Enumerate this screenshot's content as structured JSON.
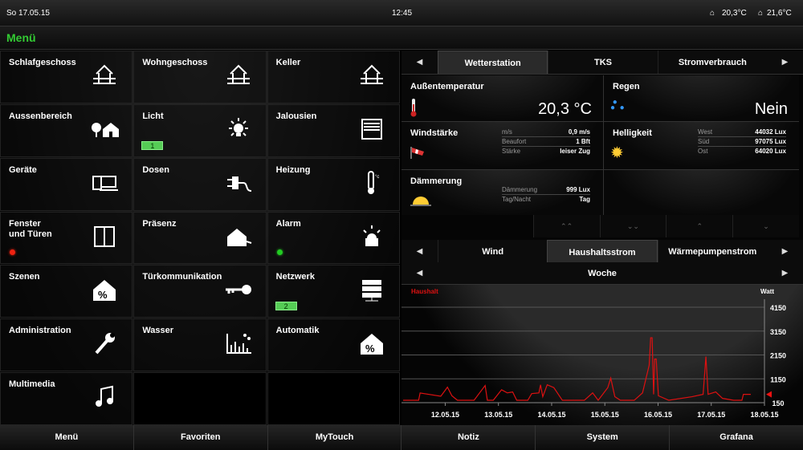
{
  "topbar": {
    "date": "So 17.05.15",
    "time": "12:45",
    "outdoor_temp": "20,3°C",
    "indoor_temp": "21,6°C"
  },
  "menubar": {
    "title": "Menü",
    "title_color": "#33cc33"
  },
  "tiles": [
    {
      "label": "Schlafgeschoss",
      "icon": "house-floor-icon"
    },
    {
      "label": "Wohngeschoss",
      "icon": "house-floor-icon"
    },
    {
      "label": "Keller",
      "icon": "house-floor-icon"
    },
    {
      "label": "Aussenbereich",
      "icon": "garden-icon"
    },
    {
      "label": "Licht",
      "icon": "bulb-icon",
      "badge": "1"
    },
    {
      "label": "Jalousien",
      "icon": "blinds-icon"
    },
    {
      "label": "Geräte",
      "icon": "laptop-icon"
    },
    {
      "label": "Dosen",
      "icon": "plug-icon"
    },
    {
      "label": "Heizung",
      "icon": "thermometer-icon"
    },
    {
      "label": "Fenster\nund Türen",
      "icon": "window-icon",
      "led": "#e21"
    },
    {
      "label": "Präsenz",
      "icon": "presence-icon"
    },
    {
      "label": "Alarm",
      "icon": "siren-icon",
      "led": "#2c2"
    },
    {
      "label": "Szenen",
      "icon": "house-percent-icon"
    },
    {
      "label": "Türkommunikation",
      "icon": "key-icon"
    },
    {
      "label": "Netzwerk",
      "icon": "server-icon",
      "badge": "2"
    },
    {
      "label": "Administration",
      "icon": "wrench-icon"
    },
    {
      "label": "Wasser",
      "icon": "water-chart-icon"
    },
    {
      "label": "Automatik",
      "icon": "house-percent-icon"
    },
    {
      "label": "Multimedia",
      "icon": "music-icon"
    }
  ],
  "top_tabs": {
    "items": [
      "Wetterstation",
      "TKS",
      "Stromverbrauch"
    ],
    "active": 0
  },
  "weather": {
    "temp": {
      "title": "Außentemperatur",
      "value": "20,3 °C"
    },
    "rain": {
      "title": "Regen",
      "value": "Nein"
    },
    "wind": {
      "title": "Windstärke",
      "rows": [
        {
          "k": "m/s",
          "v": "0,9 m/s"
        },
        {
          "k": "Beaufort",
          "v": "1 Bft"
        },
        {
          "k": "Stärke",
          "v": "leiser Zug"
        }
      ]
    },
    "light": {
      "title": "Helligkeit",
      "rows": [
        {
          "k": "West",
          "v": "44032 Lux"
        },
        {
          "k": "Süd",
          "v": "97075 Lux"
        },
        {
          "k": "Ost",
          "v": "64020 Lux"
        }
      ]
    },
    "dusk": {
      "title": "Dämmerung",
      "rows": [
        {
          "k": "Dämmerung",
          "v": "999 Lux"
        },
        {
          "k": "Tag/Nacht",
          "v": "Tag"
        }
      ]
    }
  },
  "chart_tabs": {
    "items": [
      "Wind",
      "Haushaltsstrom",
      "Wärmepumpenstrom"
    ],
    "active": 1,
    "period": "Woche"
  },
  "chart_data": {
    "type": "line",
    "series": [
      {
        "name": "Haushalt",
        "color": "#dd1111",
        "points": [
          [
            "2015-05-11T05:00",
            250
          ],
          [
            "2015-05-11T12:00",
            250
          ],
          [
            "2015-05-11T12:40",
            557
          ],
          [
            "2015-05-11T22:00",
            420
          ],
          [
            "2015-05-12T00:00",
            670
          ],
          [
            "2015-05-12T01:00",
            800
          ],
          [
            "2015-05-12T03:00",
            440
          ],
          [
            "2015-05-12T05:30",
            250
          ],
          [
            "2015-05-12T13:00",
            250
          ],
          [
            "2015-05-12T15:30",
            560
          ],
          [
            "2015-05-12T18:00",
            870
          ],
          [
            "2015-05-12T19:00",
            250
          ],
          [
            "2015-05-12T21:40",
            250
          ],
          [
            "2015-05-13T01:25",
            690
          ],
          [
            "2015-05-13T04:00",
            560
          ],
          [
            "2015-05-13T06:25",
            600
          ],
          [
            "2015-05-13T08:15",
            250
          ],
          [
            "2015-05-13T13:15",
            250
          ],
          [
            "2015-05-13T15:00",
            530
          ],
          [
            "2015-05-13T18:15",
            560
          ],
          [
            "2015-05-13T19:00",
            900
          ],
          [
            "2015-05-13T20:00",
            400
          ],
          [
            "2015-05-13T22:00",
            900
          ],
          [
            "2015-05-14T01:00",
            780
          ],
          [
            "2015-05-14T04:50",
            250
          ],
          [
            "2015-05-14T14:45",
            250
          ],
          [
            "2015-05-14T18:30",
            560
          ],
          [
            "2015-05-14T21:00",
            250
          ],
          [
            "2015-05-15T01:20",
            780
          ],
          [
            "2015-05-15T02:40",
            1180
          ],
          [
            "2015-05-15T04:30",
            400
          ],
          [
            "2015-05-15T07:00",
            250
          ],
          [
            "2015-05-15T13:15",
            250
          ],
          [
            "2015-05-15T17:00",
            560
          ],
          [
            "2015-05-15T20:00",
            1720
          ],
          [
            "2015-05-15T20:40",
            2870
          ],
          [
            "2015-05-15T21:20",
            2870
          ],
          [
            "2015-05-15T22:00",
            500
          ],
          [
            "2015-05-15T22:30",
            1980
          ],
          [
            "2015-05-15T23:10",
            1980
          ],
          [
            "2015-05-16T00:10",
            440
          ],
          [
            "2015-05-16T04:50",
            250
          ],
          [
            "2015-05-16T15:20",
            400
          ],
          [
            "2015-05-16T20:20",
            500
          ],
          [
            "2015-05-16T21:35",
            2080
          ],
          [
            "2015-05-16T22:35",
            500
          ],
          [
            "2015-05-17T02:00",
            600
          ],
          [
            "2015-05-17T05:05",
            330
          ],
          [
            "2015-05-17T10:05",
            250
          ],
          [
            "2015-05-17T13:50",
            250
          ],
          [
            "2015-05-17T14:30",
            500
          ],
          [
            "2015-05-17T17:50",
            500
          ]
        ]
      }
    ],
    "ylabel": "Watt",
    "yticks": [
      150,
      1150,
      2150,
      3150,
      4150
    ],
    "ylim": [
      150,
      4150
    ],
    "xticks": [
      "12.05.15",
      "13.05.15",
      "14.05.15",
      "15.05.15",
      "16.05.15",
      "17.05.15",
      "18.05.15"
    ],
    "xlim": [
      "2015-05-11T05:00",
      "2015-05-18T00:00"
    ],
    "current_marker": 500,
    "grid": true
  },
  "bottombar": [
    "Menü",
    "Favoriten",
    "MyTouch",
    "Notiz",
    "System",
    "Grafana"
  ]
}
